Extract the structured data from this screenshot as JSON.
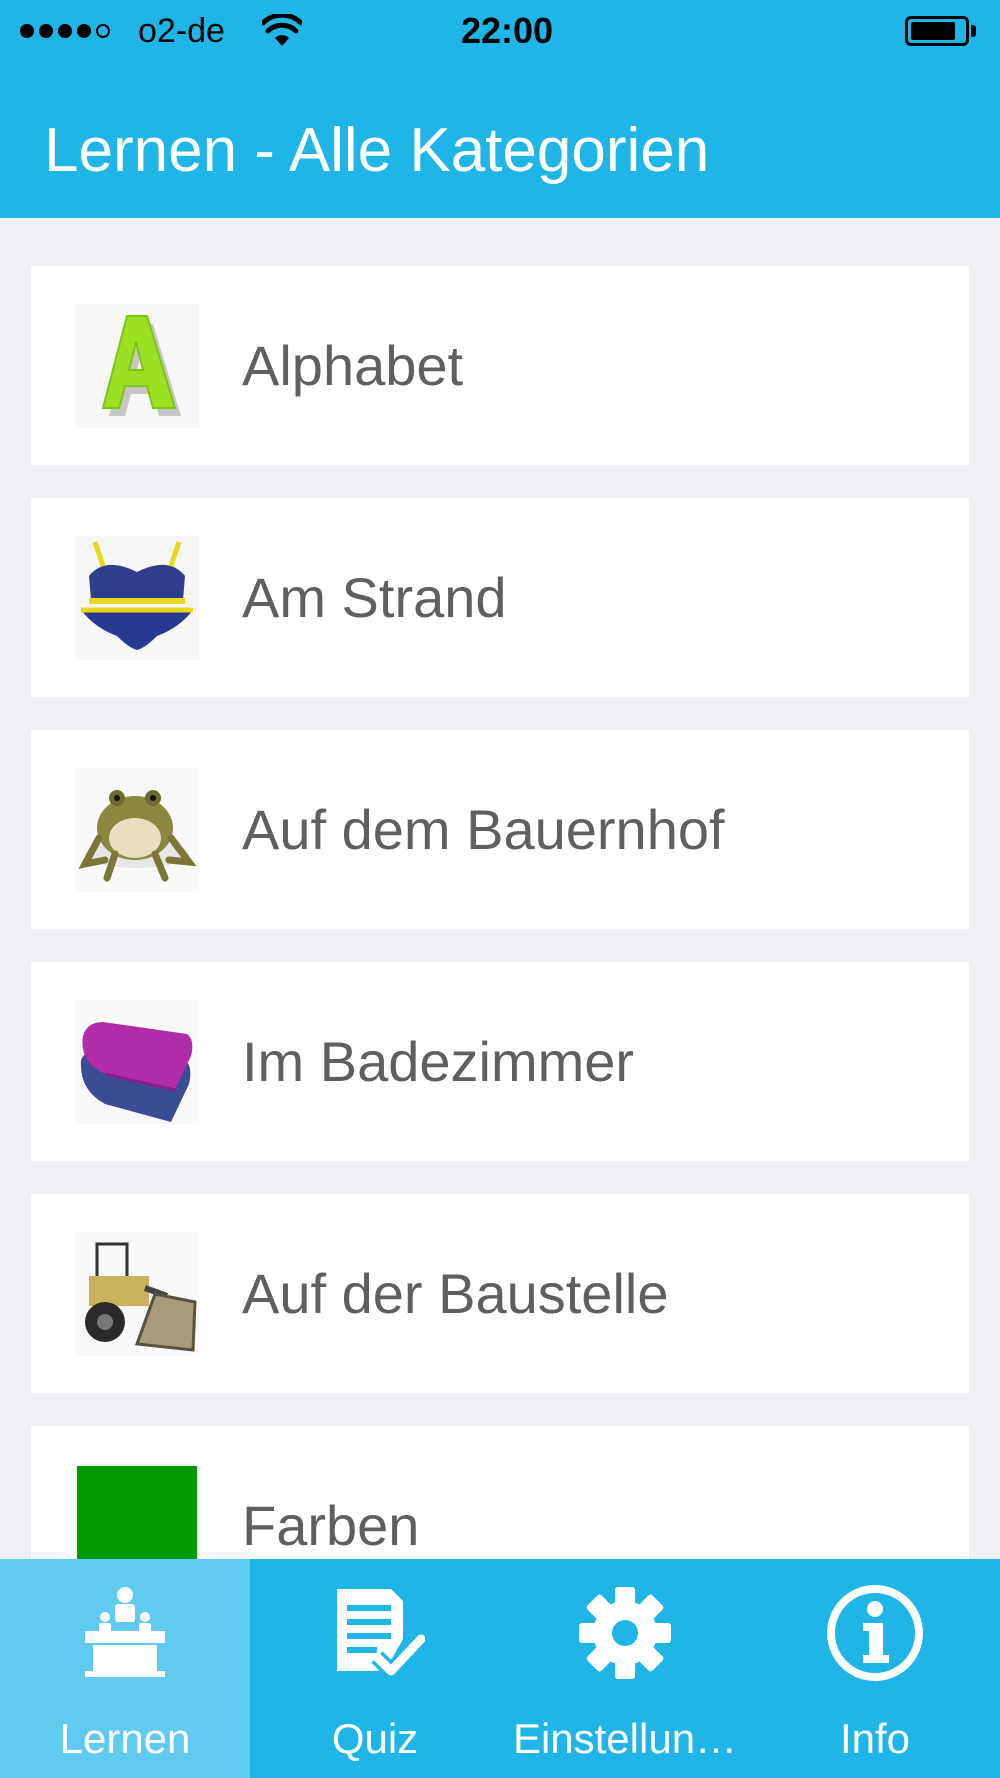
{
  "status_bar": {
    "carrier": "o2-de",
    "time": "22:00",
    "signal_bars": 4,
    "signal_total": 5,
    "battery_level": 0.85
  },
  "nav": {
    "title": "Lernen - Alle Kategorien"
  },
  "colors": {
    "primary": "#1fb5e6",
    "tab_active": "#61cbef",
    "background": "#efeff4",
    "row_text": "#5f5f5f"
  },
  "categories": [
    {
      "label": "Alphabet",
      "icon": "letter-a-icon"
    },
    {
      "label": "Am Strand",
      "icon": "bikini-icon"
    },
    {
      "label": "Auf dem Bauernhof",
      "icon": "frog-icon"
    },
    {
      "label": "Im Badezimmer",
      "icon": "towels-icon"
    },
    {
      "label": "Auf der Baustelle",
      "icon": "bulldozer-icon"
    },
    {
      "label": "Farben",
      "icon": "green-square-icon"
    }
  ],
  "tabs": [
    {
      "label": "Lernen",
      "icon": "teacher-desk-icon",
      "active": true
    },
    {
      "label": "Quiz",
      "icon": "checklist-icon",
      "active": false
    },
    {
      "label": "Einstellun…",
      "icon": "gear-icon",
      "active": false
    },
    {
      "label": "Info",
      "icon": "info-icon",
      "active": false
    }
  ]
}
